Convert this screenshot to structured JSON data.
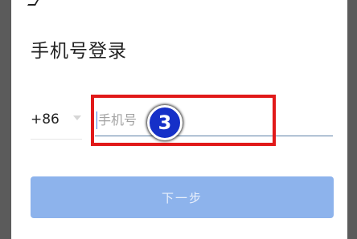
{
  "login": {
    "title": "手机号登录",
    "country_code": "+86",
    "phone_placeholder": "手机号",
    "phone_value": "",
    "next_label": "下一步"
  },
  "annotation": {
    "step_number": "3",
    "highlight_color": "#e11919",
    "badge_color": "#1530c8"
  },
  "colors": {
    "next_button_bg": "#8db3ec",
    "input_underline": "#5a7fa6"
  }
}
